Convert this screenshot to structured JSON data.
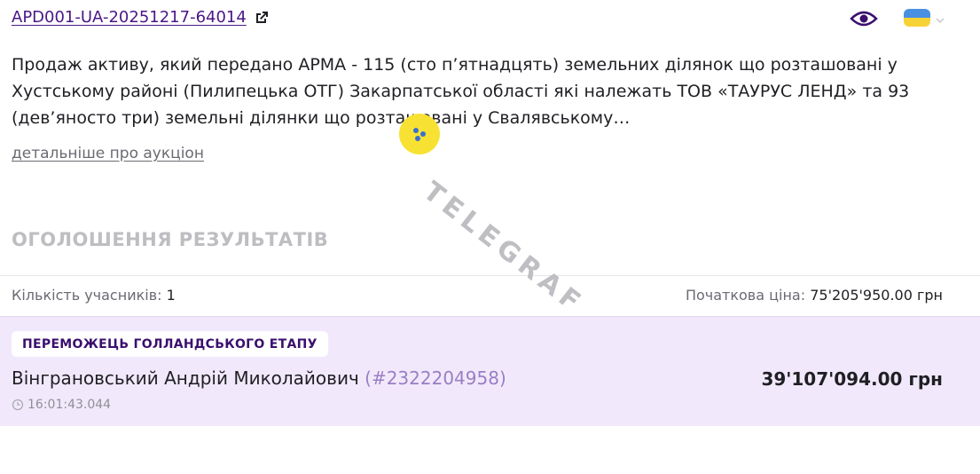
{
  "header": {
    "auction_id": "APD001-UA-20251217-64014",
    "external_link_icon": "external-link-icon",
    "view_icon": "eye-icon",
    "language": {
      "flag": "ua-flag",
      "icon": "chevron-down-icon"
    }
  },
  "description": {
    "text": "Продаж активу, який передано АРМА - 115 (сто п’ятнадцять) земельних ділянок що розташовані у Хустському районі (Пилипецька ОТГ) Закарпатської області які належать ТОВ «ТАУРУС ЛЕНД» та 93 (дев’яносто три) земельні ділянки що розташовані у Свалявському…",
    "more_link": "детальніше про аукціон"
  },
  "results": {
    "title": "ОГОЛОШЕННЯ РЕЗУЛЬТАТІВ",
    "participants_label": "Кількість учасників:",
    "participants_value": "1",
    "start_price_label": "Початкова ціна:",
    "start_price_value": "75'205'950.00 грн",
    "winner": {
      "badge": "ПЕРЕМОЖЕЦЬ ГОЛЛАНДСЬКОГО ЕТАПУ",
      "name": "Вінграновський Андрій Миколайович",
      "code": "(#2322204958)",
      "time": "16:01:43.044",
      "amount": "39'107'094.00 грн"
    }
  },
  "watermark": {
    "text": "TELEGRAF"
  },
  "colors": {
    "accent": "#4b1787",
    "winner_bg": "#f1e9fb",
    "muted": "#6a6a72",
    "watermark_yellow": "#f7e233"
  }
}
